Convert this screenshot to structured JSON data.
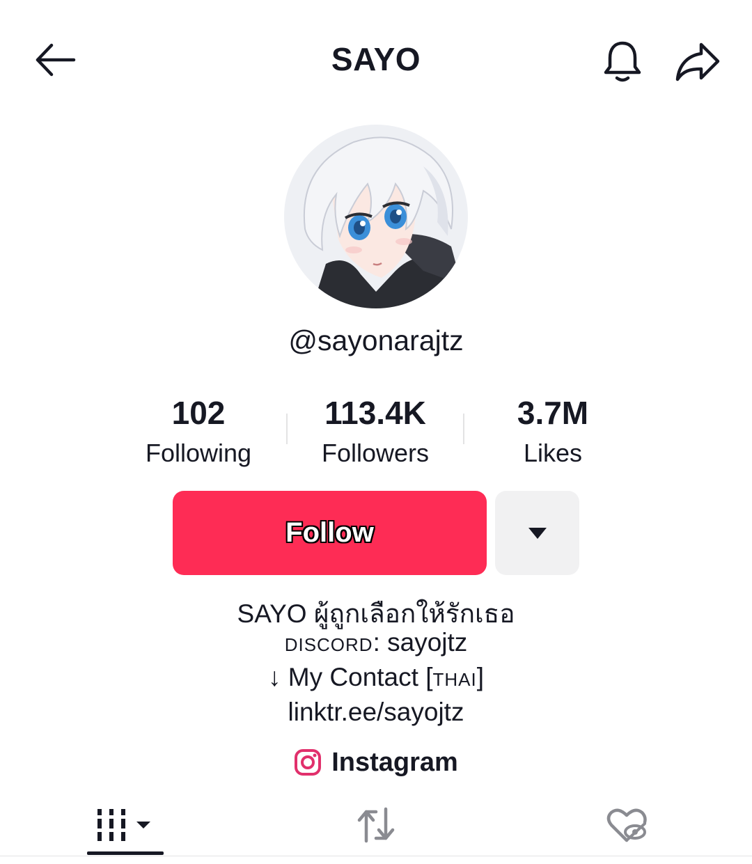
{
  "header": {
    "title": "SAYO",
    "back_icon": "arrow-left-icon",
    "notification_icon": "bell-icon",
    "share_icon": "share-arrow-icon"
  },
  "profile": {
    "avatar": "avatar-anime-girl",
    "handle": "@sayonarajtz"
  },
  "stats": [
    {
      "value": "102",
      "label": "Following"
    },
    {
      "value": "113.4K",
      "label": "Followers"
    },
    {
      "value": "3.7M",
      "label": "Likes"
    }
  ],
  "actions": {
    "follow_label": "Follow",
    "more_icon": "caret-down-icon",
    "accent_color": "#fe2c55"
  },
  "bio": {
    "line1": "SAYO ผู้ถูกเลือกให้รักเธอ",
    "line2_prefix": "discord",
    "line2_suffix": ": sayojtz",
    "line3_prefix": "↓ My Contact [",
    "line3_caps": "thai",
    "line3_suffix": "]",
    "line4": "linktr.ee/sayojtz"
  },
  "link": {
    "label": "Instagram",
    "icon": "instagram-icon"
  },
  "tabs": [
    {
      "name": "videos",
      "icon": "grid-bars-icon",
      "active": true
    },
    {
      "name": "reposts",
      "icon": "repost-icon",
      "active": false
    },
    {
      "name": "liked",
      "icon": "hidden-heart-icon",
      "active": false
    }
  ]
}
